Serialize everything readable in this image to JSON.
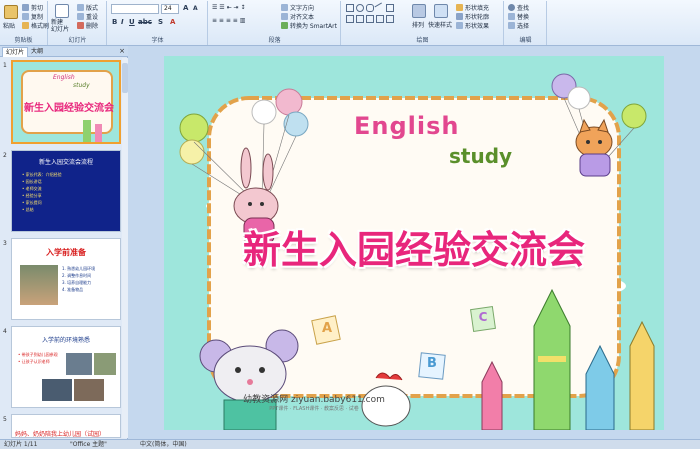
{
  "ribbon": {
    "clipboard": {
      "paste": "粘贴",
      "cut": "剪切",
      "copy": "复制",
      "painter": "格式刷",
      "group": "剪贴板"
    },
    "slides": {
      "new_slide": "新建\n幻灯片",
      "layout": "版式",
      "reset": "重设",
      "delete": "删除",
      "group": "幻灯片"
    },
    "font": {
      "font_name": "",
      "font_size": "24",
      "group": "字体"
    },
    "paragraph": {
      "text_direction": "文字方向",
      "align_text": "对齐文本",
      "smartart": "转换为 SmartArt",
      "group": "段落"
    },
    "drawing": {
      "arrange": "排列",
      "quick_styles": "快速样式",
      "fill": "形状填充",
      "outline": "形状轮廓",
      "effects": "形状效果",
      "group": "绘图"
    },
    "editing": {
      "find": "查找",
      "replace": "替换",
      "select": "选择",
      "group": "编辑"
    }
  },
  "panel": {
    "tabs": [
      "幻灯片",
      "大纲"
    ],
    "slides": [
      {
        "num": "1",
        "title": "新生入园经验交流会",
        "en1": "English",
        "en2": "study"
      },
      {
        "num": "2",
        "title": "新生入园交流会流程",
        "lines": [
          "• 家长代表：介绍经验",
          "• 园长讲话",
          "• 老师交流",
          "• 经验分享",
          "• 家长提问",
          "• 总结"
        ]
      },
      {
        "num": "3",
        "title": "入学前准备",
        "lines": [
          "1. 熟悉幼儿园环境",
          "2. 调整作息时间",
          "3. 培养自理能力",
          "4. 准备物品"
        ]
      },
      {
        "num": "4",
        "title": "入学前的环境熟悉",
        "lines": [
          "• 带孩子到幼儿园参观",
          "• 让孩子认识老师"
        ]
      },
      {
        "num": "5",
        "title": "妈妈、奶奶陪我上幼儿园（试园）"
      }
    ]
  },
  "slide": {
    "english": "English",
    "study": "study",
    "title": "新生入园经验交流会",
    "footer_main": "幼教资源网 ziyuan.baby611.com",
    "footer_sub": "PPT课件 · FLASH课件 · 教案反思 · 试卷",
    "block_a": "A",
    "block_b": "B",
    "block_c": "C",
    "colors": {
      "title": "#e8267c",
      "frame": "#e2a24a",
      "bg": "#9ee6dc"
    }
  },
  "status": {
    "slide_count": "幻灯片 1/11",
    "theme": "\"Office 主题\"",
    "language": "中文(简体，中国)"
  }
}
